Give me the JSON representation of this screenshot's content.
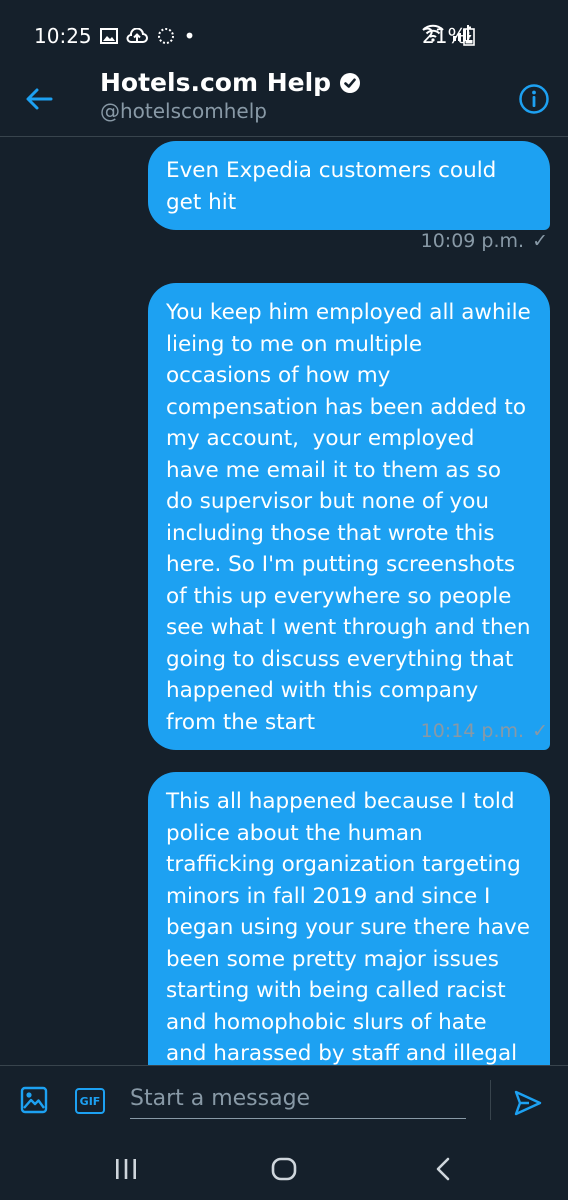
{
  "status_bar": {
    "time": "10:25",
    "dot": "•",
    "battery": "21%"
  },
  "header": {
    "title": "Hotels.com Help",
    "handle": "@hotelscomhelp"
  },
  "messages": [
    {
      "text": "Even Expedia customers could get hit",
      "time": "10:09 p.m.",
      "check": "✓"
    },
    {
      "text": "You keep him employed all awhile lieing to me on multiple occasions of how my compensation has been added to my account,  your employed have me email it to them as so do supervisor but none of you including those that wrote this here. So I'm putting screenshots of this up everywhere so people see what I went through and then  going to discuss everything that happened with this company from the start",
      "time": "10:14 p.m.",
      "check": "✓"
    },
    {
      "text": "This all happened because I told police about the human trafficking organization targeting minors in fall 2019 and since I began using your sure there have been some pretty major issues starting with being called racist and homophobic slurs of hate and harassed by staff and illegal"
    }
  ],
  "composer": {
    "placeholder": "Start a message",
    "gif_label": "GIF"
  },
  "colors": {
    "background": "#15202b",
    "accent": "#1da1f2",
    "muted": "#8899a6",
    "divider": "#38444d"
  },
  "icons": [
    "back-arrow-icon",
    "verified-badge-icon",
    "info-icon",
    "image-icon",
    "gif-icon",
    "send-icon",
    "recent-apps-icon",
    "home-icon",
    "back-nav-icon"
  ]
}
